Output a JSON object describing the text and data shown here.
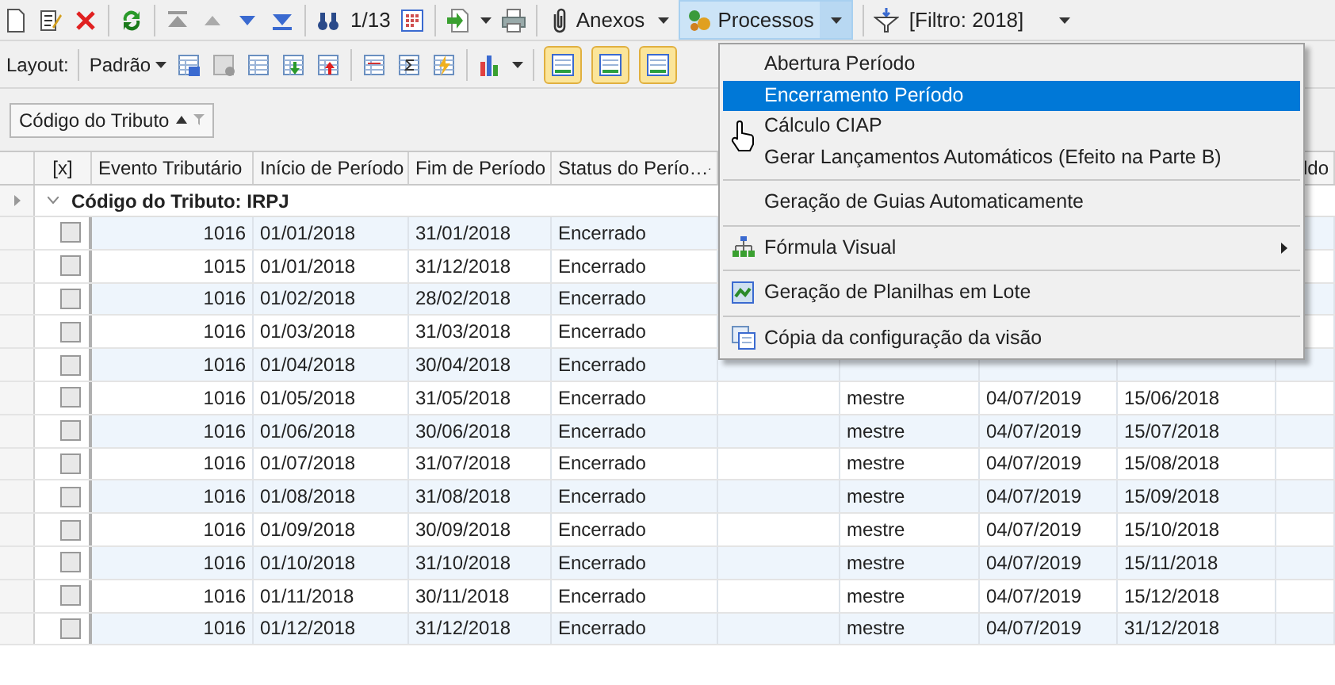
{
  "toolbar": {
    "record_position": "1/13",
    "attachments": "Anexos",
    "processes": {
      "label": "Processos",
      "expanded": true
    },
    "filter": "[Filtro: 2018]"
  },
  "layout_bar": {
    "label": "Layout:",
    "layout": "Padrão",
    "toggles": [
      {
        "selected": true
      },
      {
        "selected": true
      },
      {
        "selected": true
      }
    ]
  },
  "group_panel": {
    "chip": "Código do Tributo"
  },
  "table": {
    "columns": [
      {
        "label": "[x]"
      },
      {
        "label": "Evento Tributário"
      },
      {
        "label": "Início de Período"
      },
      {
        "label": "Fim de Período"
      },
      {
        "label": "Status do Perío…",
        "sorted": true
      },
      {},
      {},
      {},
      {},
      {
        "label": "ldo"
      }
    ],
    "group": {
      "label": "Código do Tributo: IRPJ",
      "expanded": true
    },
    "rows": [
      {
        "checked": false,
        "evento": "1016",
        "inicio": "01/01/2018",
        "fim": "31/01/2018",
        "status": "Encerrado"
      },
      {
        "checked": false,
        "evento": "1015",
        "inicio": "01/01/2018",
        "fim": "31/12/2018",
        "status": "Encerrado"
      },
      {
        "checked": false,
        "evento": "1016",
        "inicio": "01/02/2018",
        "fim": "28/02/2018",
        "status": "Encerrado"
      },
      {
        "checked": false,
        "evento": "1016",
        "inicio": "01/03/2018",
        "fim": "31/03/2018",
        "status": "Encerrado"
      },
      {
        "checked": false,
        "evento": "1016",
        "inicio": "01/04/2018",
        "fim": "30/04/2018",
        "status": "Encerrado"
      },
      {
        "checked": false,
        "evento": "1016",
        "inicio": "01/05/2018",
        "fim": "31/05/2018",
        "status": "Encerrado",
        "user": "mestre",
        "column_8": "04/07/2019",
        "column_9": "15/06/2018"
      },
      {
        "checked": false,
        "evento": "1016",
        "inicio": "01/06/2018",
        "fim": "30/06/2018",
        "status": "Encerrado",
        "user": "mestre",
        "column_8": "04/07/2019",
        "column_9": "15/07/2018"
      },
      {
        "checked": false,
        "evento": "1016",
        "inicio": "01/07/2018",
        "fim": "31/07/2018",
        "status": "Encerrado",
        "user": "mestre",
        "column_8": "04/07/2019",
        "column_9": "15/08/2018"
      },
      {
        "checked": false,
        "evento": "1016",
        "inicio": "01/08/2018",
        "fim": "31/08/2018",
        "status": "Encerrado",
        "user": "mestre",
        "column_8": "04/07/2019",
        "column_9": "15/09/2018"
      },
      {
        "checked": false,
        "evento": "1016",
        "inicio": "01/09/2018",
        "fim": "30/09/2018",
        "status": "Encerrado",
        "user": "mestre",
        "column_8": "04/07/2019",
        "column_9": "15/10/2018"
      },
      {
        "checked": false,
        "evento": "1016",
        "inicio": "01/10/2018",
        "fim": "31/10/2018",
        "status": "Encerrado",
        "user": "mestre",
        "column_8": "04/07/2019",
        "column_9": "15/11/2018"
      },
      {
        "checked": false,
        "evento": "1016",
        "inicio": "01/11/2018",
        "fim": "30/11/2018",
        "status": "Encerrado",
        "user": "mestre",
        "column_8": "04/07/2019",
        "column_9": "15/12/2018"
      },
      {
        "checked": false,
        "evento": "1016",
        "inicio": "01/12/2018",
        "fim": "31/12/2018",
        "status": "Encerrado",
        "user": "mestre",
        "column_8": "04/07/2019",
        "column_9": "31/12/2018"
      }
    ]
  },
  "processes_menu": {
    "items": [
      {
        "kind": "item",
        "label": "Abertura Período",
        "selected": false
      },
      {
        "kind": "item",
        "label": "Encerramento Período",
        "selected": true
      },
      {
        "kind": "item",
        "label": "Cálculo CIAP",
        "selected": false,
        "cursor": true
      },
      {
        "kind": "item",
        "label": "Gerar Lançamentos Automáticos (Efeito na Parte B)",
        "selected": false
      },
      {
        "kind": "separator"
      },
      {
        "kind": "item",
        "label": "Geração de Guias Automaticamente",
        "selected": false
      },
      {
        "kind": "separator"
      },
      {
        "kind": "submenu",
        "label": "Fórmula Visual",
        "selected": false
      },
      {
        "kind": "separator"
      },
      {
        "kind": "item",
        "label": "Geração de Planilhas em Lote",
        "selected": false
      },
      {
        "kind": "separator"
      },
      {
        "kind": "item",
        "label": "Cópia da configuração da visão",
        "selected": false
      }
    ]
  }
}
